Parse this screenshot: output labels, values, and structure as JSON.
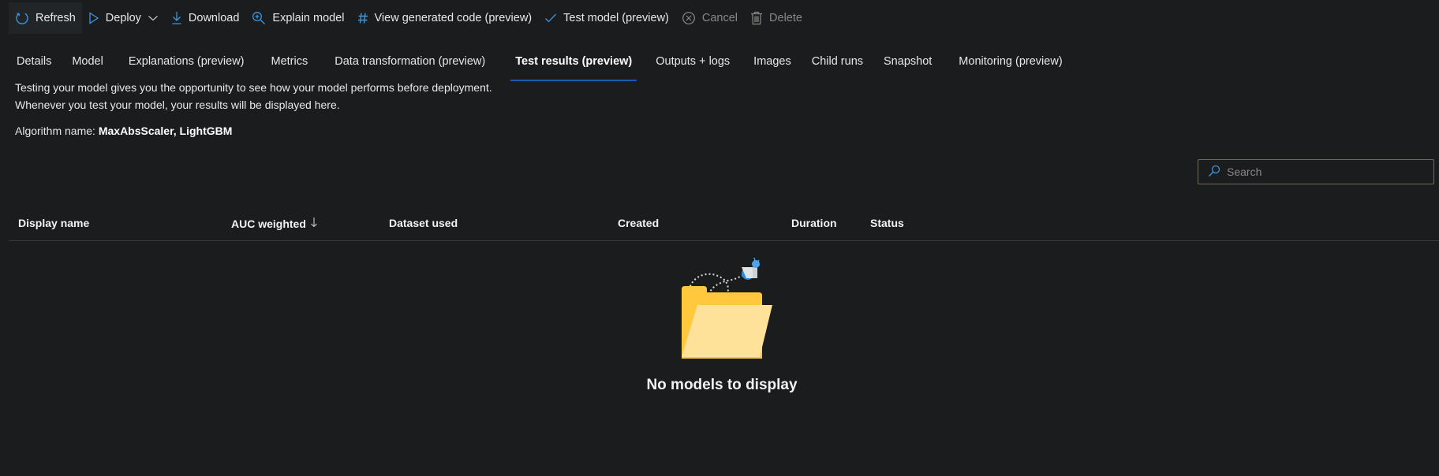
{
  "toolbar": {
    "refresh": {
      "label": "Refresh",
      "icon": "refresh-icon"
    },
    "deploy": {
      "label": "Deploy",
      "icon": "play-icon",
      "dropdown_icon": "chevron-down-icon"
    },
    "download": {
      "label": "Download",
      "icon": "download-icon"
    },
    "explain_model": {
      "label": "Explain model",
      "icon": "zoom-in-icon"
    },
    "view_code": {
      "label": "View generated code (preview)",
      "icon": "hashtag-icon"
    },
    "test_model": {
      "label": "Test model (preview)",
      "icon": "checkmark-icon"
    },
    "cancel": {
      "label": "Cancel",
      "icon": "cancel-circle-icon",
      "disabled": true
    },
    "delete": {
      "label": "Delete",
      "icon": "trash-icon",
      "disabled": true
    }
  },
  "tabs": [
    {
      "label": "Details"
    },
    {
      "label": "Model"
    },
    {
      "label": "Explanations (preview)"
    },
    {
      "label": "Metrics"
    },
    {
      "label": "Data transformation (preview)"
    },
    {
      "label": "Test results (preview)",
      "selected": true
    },
    {
      "label": "Outputs + logs"
    },
    {
      "label": "Images"
    },
    {
      "label": "Child runs"
    },
    {
      "label": "Snapshot"
    },
    {
      "label": "Monitoring (preview)"
    }
  ],
  "description": {
    "line1": "Testing your model gives you the opportunity to see how your model performs before deployment.",
    "line2": "Whenever you test your model, your results will be displayed here."
  },
  "algorithm": {
    "label": "Algorithm name:",
    "value": "MaxAbsScaler, LightGBM"
  },
  "search": {
    "placeholder": "Search",
    "value": "",
    "icon": "search-icon"
  },
  "table": {
    "columns": [
      {
        "label": "Display name"
      },
      {
        "label": "AUC weighted",
        "sort": "descending",
        "sort_icon": "arrow-down-icon"
      },
      {
        "label": "Dataset used"
      },
      {
        "label": "Created"
      },
      {
        "label": "Duration"
      },
      {
        "label": "Status"
      }
    ],
    "rows": []
  },
  "empty_state": {
    "message": "No models to display",
    "illustration": "empty-folder-illustration"
  },
  "colors": {
    "background": "#1b1c1e",
    "accent": "#1a5ab8",
    "icon_blue": "#3a96dd",
    "folder_dark": "#ffc83d",
    "folder_light": "#ffe29a"
  }
}
